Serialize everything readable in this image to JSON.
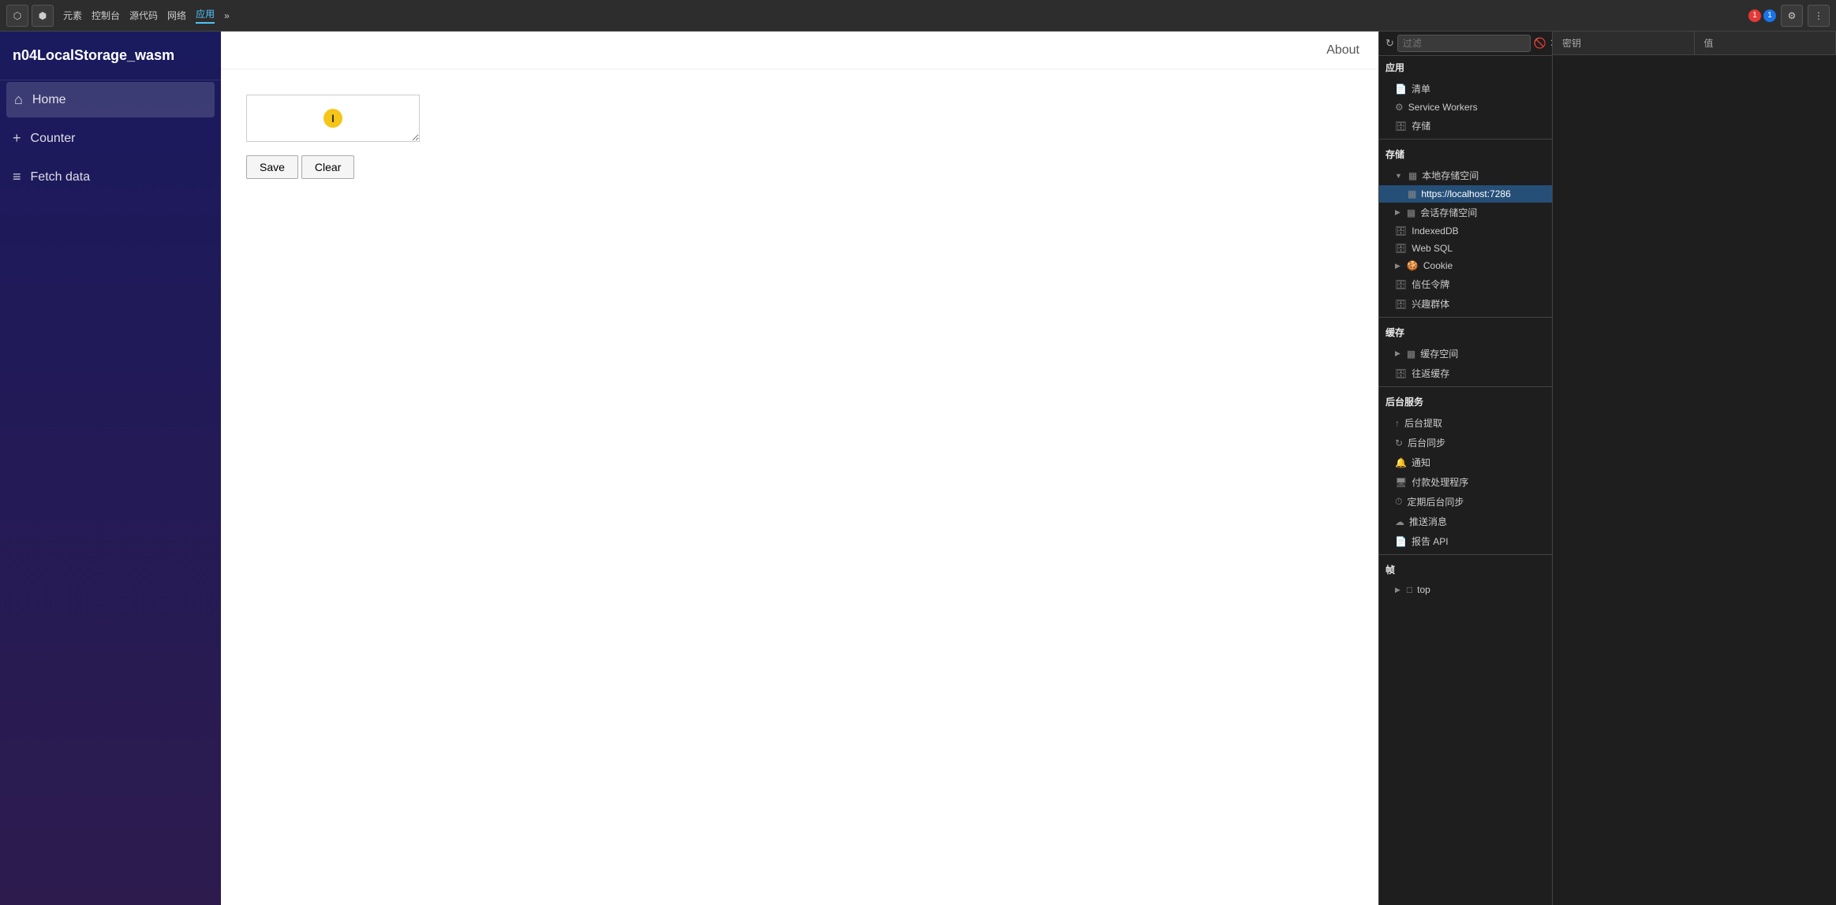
{
  "app": {
    "title": "n04LocalStorage_wasm",
    "about_label": "About"
  },
  "nav": {
    "items": [
      {
        "id": "home",
        "label": "Home",
        "icon": "⌂",
        "active": true
      },
      {
        "id": "counter",
        "label": "Counter",
        "icon": "+",
        "active": false
      },
      {
        "id": "fetch",
        "label": "Fetch data",
        "icon": "≡",
        "active": false
      }
    ]
  },
  "main": {
    "textarea_placeholder": "",
    "save_label": "Save",
    "clear_label": "Clear"
  },
  "devtools": {
    "tabs": [
      {
        "id": "cursor",
        "label": "🖱",
        "active": false
      },
      {
        "id": "memory",
        "label": "💾",
        "active": false
      },
      {
        "id": "elements",
        "label": "元素",
        "active": false
      },
      {
        "id": "console",
        "label": "控制台",
        "active": false
      },
      {
        "id": "sources",
        "label": "源代码",
        "active": false
      },
      {
        "id": "network",
        "label": "网络",
        "active": false
      },
      {
        "id": "application",
        "label": "应用",
        "active": true
      },
      {
        "id": "more",
        "label": "»",
        "active": false
      }
    ],
    "badges": {
      "red": "1",
      "blue": "1"
    },
    "filter_placeholder": "过滤",
    "kv_headers": [
      "密钥",
      "值"
    ],
    "tree": {
      "sections": [
        {
          "id": "yingyong",
          "label": "应用",
          "expanded": true,
          "children": [
            {
              "id": "qingjian",
              "label": "清单",
              "icon": "📄",
              "indent": 1
            },
            {
              "id": "service-workers",
              "label": "Service Workers",
              "icon": "⚙",
              "indent": 1
            },
            {
              "id": "cunchu",
              "label": "存储",
              "icon": "🗄",
              "indent": 1
            }
          ]
        },
        {
          "id": "cunchu",
          "label": "存储",
          "expanded": true,
          "children": [
            {
              "id": "local-storage",
              "label": "本地存储空间",
              "icon": "▦",
              "indent": 1,
              "expanded": true
            },
            {
              "id": "localhost-7286",
              "label": "https://localhost:7286",
              "icon": "▦",
              "indent": 2,
              "active": true
            },
            {
              "id": "session-storage",
              "label": "会话存储空间",
              "icon": "▦",
              "indent": 1,
              "expanded": false
            },
            {
              "id": "indexeddb",
              "label": "IndexedDB",
              "icon": "🗄",
              "indent": 1
            },
            {
              "id": "web-sql",
              "label": "Web SQL",
              "icon": "🗄",
              "indent": 1
            },
            {
              "id": "cookie",
              "label": "Cookie",
              "icon": "🍪",
              "indent": 1,
              "expanded": false
            },
            {
              "id": "trust-token",
              "label": "信任令牌",
              "icon": "🗄",
              "indent": 1
            },
            {
              "id": "interest-group",
              "label": "兴趣群体",
              "icon": "🗄",
              "indent": 1
            }
          ]
        },
        {
          "id": "huancun",
          "label": "缓存",
          "expanded": true,
          "children": [
            {
              "id": "cache-space",
              "label": "缓存空间",
              "icon": "▦",
              "indent": 1,
              "expanded": false
            },
            {
              "id": "back-cache",
              "label": "往返缓存",
              "icon": "🗄",
              "indent": 1
            }
          ]
        },
        {
          "id": "houtai",
          "label": "后台服务",
          "expanded": true,
          "children": [
            {
              "id": "houtai-fetch",
              "label": "后台提取",
              "icon": "↑",
              "indent": 1
            },
            {
              "id": "houtai-sync",
              "label": "后台同步",
              "icon": "↻",
              "indent": 1
            },
            {
              "id": "tongzhi",
              "label": "通知",
              "icon": "🔔",
              "indent": 1
            },
            {
              "id": "payment",
              "label": "付款处理程序",
              "icon": "🖥",
              "indent": 1
            },
            {
              "id": "periodic-sync",
              "label": "定期后台同步",
              "icon": "⏱",
              "indent": 1
            },
            {
              "id": "push-msg",
              "label": "推送消息",
              "icon": "☁",
              "indent": 1
            },
            {
              "id": "report-api",
              "label": "报告 API",
              "icon": "📄",
              "indent": 1
            }
          ]
        },
        {
          "id": "zhen",
          "label": "帧",
          "expanded": true,
          "children": [
            {
              "id": "top",
              "label": "top",
              "icon": "□",
              "indent": 1,
              "expanded": false
            }
          ]
        }
      ]
    }
  }
}
